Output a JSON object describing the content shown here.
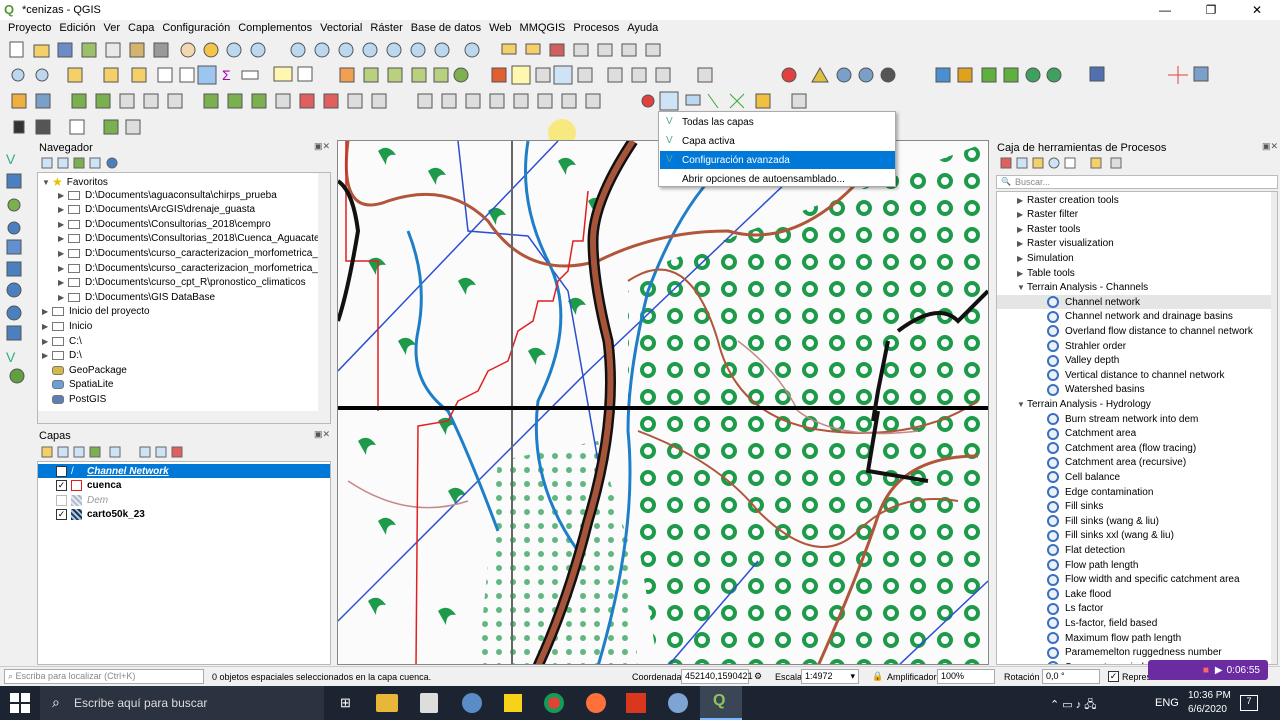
{
  "window": {
    "title": "*cenizas - QGIS",
    "minimize": "—",
    "maximize": "❐",
    "close": "✕"
  },
  "menu": [
    "Proyecto",
    "Edición",
    "Ver",
    "Capa",
    "Configuración",
    "Complementos",
    "Vectorial",
    "Ráster",
    "Base de datos",
    "Web",
    "MMQGIS",
    "Procesos",
    "Ayuda"
  ],
  "navigator": {
    "title": "Navegador",
    "items": [
      {
        "label": "Favoritos",
        "level": 0,
        "type": "star",
        "expanded": true
      },
      {
        "label": "D:\\Documents\\aguaconsulta\\chirps_prueba",
        "level": 1,
        "type": "folder"
      },
      {
        "label": "D:\\Documents\\ArcGIS\\drenaje_guasta",
        "level": 1,
        "type": "folder"
      },
      {
        "label": "D:\\Documents\\Consultorias_2018\\cempro",
        "level": 1,
        "type": "folder"
      },
      {
        "label": "D:\\Documents\\Consultorias_2018\\Cuenca_Aguacate",
        "level": 1,
        "type": "folder"
      },
      {
        "label": "D:\\Documents\\curso_caracterizacion_morfometrica_",
        "level": 1,
        "type": "folder"
      },
      {
        "label": "D:\\Documents\\curso_caracterizacion_morfometrica_",
        "level": 1,
        "type": "folder"
      },
      {
        "label": "D:\\Documents\\curso_cpt_R\\pronostico_climaticos",
        "level": 1,
        "type": "folder"
      },
      {
        "label": "D:\\Documents\\GIS DataBase",
        "level": 1,
        "type": "folder"
      },
      {
        "label": "Inicio del proyecto",
        "level": 0,
        "type": "folder"
      },
      {
        "label": "Inicio",
        "level": 0,
        "type": "folder"
      },
      {
        "label": "C:\\",
        "level": 0,
        "type": "folder"
      },
      {
        "label": "D:\\",
        "level": 0,
        "type": "folder"
      },
      {
        "label": "GeoPackage",
        "level": 0,
        "type": "gpkg"
      },
      {
        "label": "SpatiaLite",
        "level": 0,
        "type": "spatialite"
      },
      {
        "label": "PostGIS",
        "level": 0,
        "type": "postgis"
      }
    ]
  },
  "layers": {
    "title": "Capas",
    "items": [
      {
        "label": "Channel Network",
        "checked": true,
        "selected": true,
        "style": "bold-italic",
        "icon": "line"
      },
      {
        "label": "cuenca",
        "checked": true,
        "selected": false,
        "style": "bold",
        "icon": "polygon"
      },
      {
        "label": "Dem",
        "checked": false,
        "selected": false,
        "style": "italic-grey",
        "icon": "raster"
      },
      {
        "label": "carto50k_23",
        "checked": true,
        "selected": false,
        "style": "bold",
        "icon": "raster"
      }
    ]
  },
  "dropdown": {
    "items": [
      {
        "label": "Todas las capas",
        "selected": false
      },
      {
        "label": "Capa activa",
        "selected": false
      },
      {
        "label": "Configuración avanzada",
        "selected": true
      },
      {
        "label": "Abrir opciones de autoensamblado...",
        "selected": false
      }
    ]
  },
  "processing": {
    "title": "Caja de herramientas de Procesos",
    "search_placeholder": "Buscar...",
    "rows": [
      {
        "label": "Raster creation tools",
        "level": 1,
        "group": true,
        "expanded": false
      },
      {
        "label": "Raster filter",
        "level": 1,
        "group": true,
        "expanded": false
      },
      {
        "label": "Raster tools",
        "level": 1,
        "group": true,
        "expanded": false
      },
      {
        "label": "Raster visualization",
        "level": 1,
        "group": true,
        "expanded": false
      },
      {
        "label": "Simulation",
        "level": 1,
        "group": true,
        "expanded": false
      },
      {
        "label": "Table tools",
        "level": 1,
        "group": true,
        "expanded": false
      },
      {
        "label": "Terrain Analysis - Channels",
        "level": 1,
        "group": true,
        "expanded": true
      },
      {
        "label": "Channel network",
        "level": 2,
        "group": false,
        "highlight": true
      },
      {
        "label": "Channel network and drainage basins",
        "level": 2,
        "group": false
      },
      {
        "label": "Overland flow distance to channel network",
        "level": 2,
        "group": false
      },
      {
        "label": "Strahler order",
        "level": 2,
        "group": false
      },
      {
        "label": "Valley depth",
        "level": 2,
        "group": false
      },
      {
        "label": "Vertical distance to channel network",
        "level": 2,
        "group": false
      },
      {
        "label": "Watershed basins",
        "level": 2,
        "group": false
      },
      {
        "label": "Terrain Analysis - Hydrology",
        "level": 1,
        "group": true,
        "expanded": true
      },
      {
        "label": "Burn stream network into dem",
        "level": 2,
        "group": false
      },
      {
        "label": "Catchment area",
        "level": 2,
        "group": false
      },
      {
        "label": "Catchment area (flow tracing)",
        "level": 2,
        "group": false
      },
      {
        "label": "Catchment area (recursive)",
        "level": 2,
        "group": false
      },
      {
        "label": "Cell balance",
        "level": 2,
        "group": false
      },
      {
        "label": "Edge contamination",
        "level": 2,
        "group": false
      },
      {
        "label": "Fill sinks",
        "level": 2,
        "group": false
      },
      {
        "label": "Fill sinks (wang & liu)",
        "level": 2,
        "group": false
      },
      {
        "label": "Fill sinks xxl (wang & liu)",
        "level": 2,
        "group": false
      },
      {
        "label": "Flat detection",
        "level": 2,
        "group": false
      },
      {
        "label": "Flow path length",
        "level": 2,
        "group": false
      },
      {
        "label": "Flow width and specific catchment area",
        "level": 2,
        "group": false
      },
      {
        "label": "Lake flood",
        "level": 2,
        "group": false
      },
      {
        "label": "Ls factor",
        "level": 2,
        "group": false
      },
      {
        "label": "Ls-factor, field based",
        "level": 2,
        "group": false
      },
      {
        "label": "Maximum flow path length",
        "level": 2,
        "group": false
      },
      {
        "label": "Paramemelton ruggedness number",
        "level": 2,
        "group": false
      },
      {
        "label": "Saga wetness index",
        "level": 2,
        "group": false
      }
    ]
  },
  "status": {
    "locate_placeholder": "Escriba para localizar (Ctrl+K)",
    "message": "0 objetos espaciales seleccionados en la capa cuenca.",
    "coord_label": "Coordenada",
    "coord_value": "452140,1590421",
    "scale_label": "Escala",
    "scale_value": "1:4972",
    "magnifier_label": "Amplificador",
    "magnifier_value": "100%",
    "rotation_label": "Rotación",
    "rotation_value": "0,0 °",
    "render_label": "Represe"
  },
  "recording": {
    "time": "0:06:55"
  },
  "taskbar": {
    "search_placeholder": "Escribe aquí para buscar",
    "lang": "ENG",
    "time": "10:36 PM",
    "date": "6/6/2020",
    "notifications": "7"
  },
  "colors": {
    "accent": "#0078d7",
    "taskbar": "#1c2431",
    "qgis_green": "#589632",
    "map_green": "#1d9a4a"
  }
}
